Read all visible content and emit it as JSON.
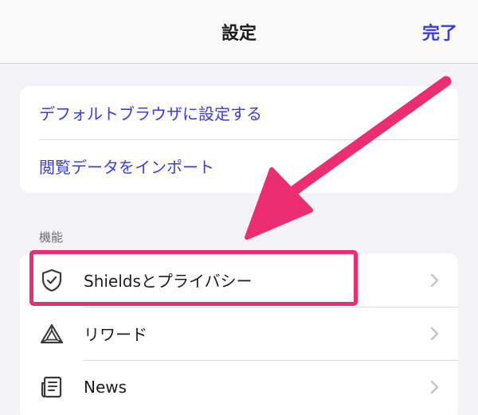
{
  "navbar": {
    "title": "設定",
    "done_label": "完了"
  },
  "general": {
    "items": [
      {
        "label": "デフォルトブラウザに設定する"
      },
      {
        "label": "閲覧データをインポート"
      }
    ]
  },
  "features": {
    "header": "機能",
    "items": [
      {
        "label": "Shieldsとプライバシー",
        "icon": "shield-check-icon"
      },
      {
        "label": "リワード",
        "icon": "rewards-triangle-icon"
      },
      {
        "label": "News",
        "icon": "news-icon"
      }
    ]
  },
  "colors": {
    "accent": "#3b3fd6",
    "annotation": "#ec2d72",
    "background": "#f2f2f7"
  }
}
